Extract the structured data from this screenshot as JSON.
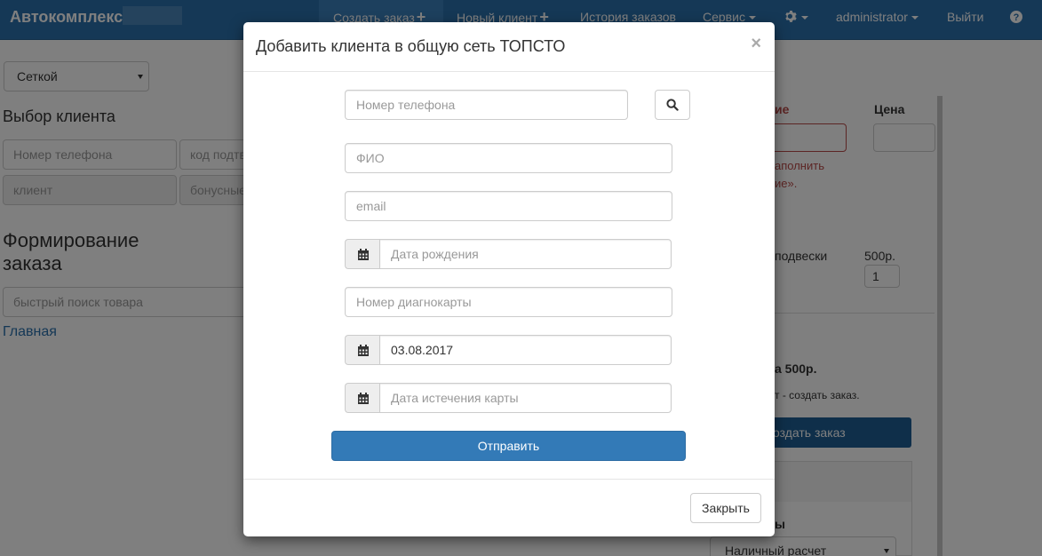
{
  "navbar": {
    "brand": "Автокомплекс",
    "items": [
      {
        "label": "Создать заказ",
        "icon": "plus-icon"
      },
      {
        "label": "Новый клиент",
        "icon": "plus-icon"
      },
      {
        "label": "История заказов"
      },
      {
        "label": "Сервис",
        "icon": "caret-down-icon"
      },
      {
        "icon": "gear-icon"
      },
      {
        "label": "administrator",
        "icon": "caret-down-icon"
      },
      {
        "label": "Выйти"
      },
      {
        "icon": "help-icon"
      }
    ],
    "colors": {
      "background": "#2a70ad",
      "active": "#3a80bd"
    }
  },
  "background_page": {
    "view_select": "Сеткой",
    "client_heading": "Выбор клиента",
    "client_fields": {
      "phone_placeholder": "Номер телефона",
      "code_placeholder": "код подтв",
      "client_placeholder": "клиент",
      "bonus_placeholder": "бонусные"
    },
    "order_heading": "Формирование заказа",
    "quick_search_placeholder": "быстрый поиск товара",
    "main_link": "Главная",
    "right_panel": {
      "name_label": "ие",
      "price_label": "Цена",
      "error_line1": "аполнить",
      "error_line2": "ие».",
      "item_name": "подвески",
      "item_price": "500р.",
      "item_qty": "1",
      "total": "а 500р.",
      "hint": "т - создать заказ.",
      "create_button": "оздать заказ",
      "payment_label": "ы",
      "payment_select": "Наличный расчет"
    }
  },
  "modal": {
    "title": "Добавить клиента в общую сеть ТОПСТО",
    "close_symbol": "×",
    "fields": {
      "phone": {
        "placeholder": "Номер телефона",
        "value": ""
      },
      "fio": {
        "placeholder": "ФИО",
        "value": ""
      },
      "email": {
        "placeholder": "email",
        "value": ""
      },
      "birth_date": {
        "placeholder": "Дата рождения",
        "value": "",
        "icon": "calendar-icon"
      },
      "card_number": {
        "placeholder": "Номер диагнокарты",
        "value": ""
      },
      "card_date": {
        "placeholder": "",
        "value": "03.08.2017",
        "icon": "calendar-icon"
      },
      "card_expiry": {
        "placeholder": "Дата истечения карты",
        "value": "",
        "icon": "calendar-icon"
      }
    },
    "search_icon": "search-icon",
    "submit_label": "Отправить",
    "close_label": "Закрыть",
    "colors": {
      "primary": "#337ab7"
    }
  }
}
